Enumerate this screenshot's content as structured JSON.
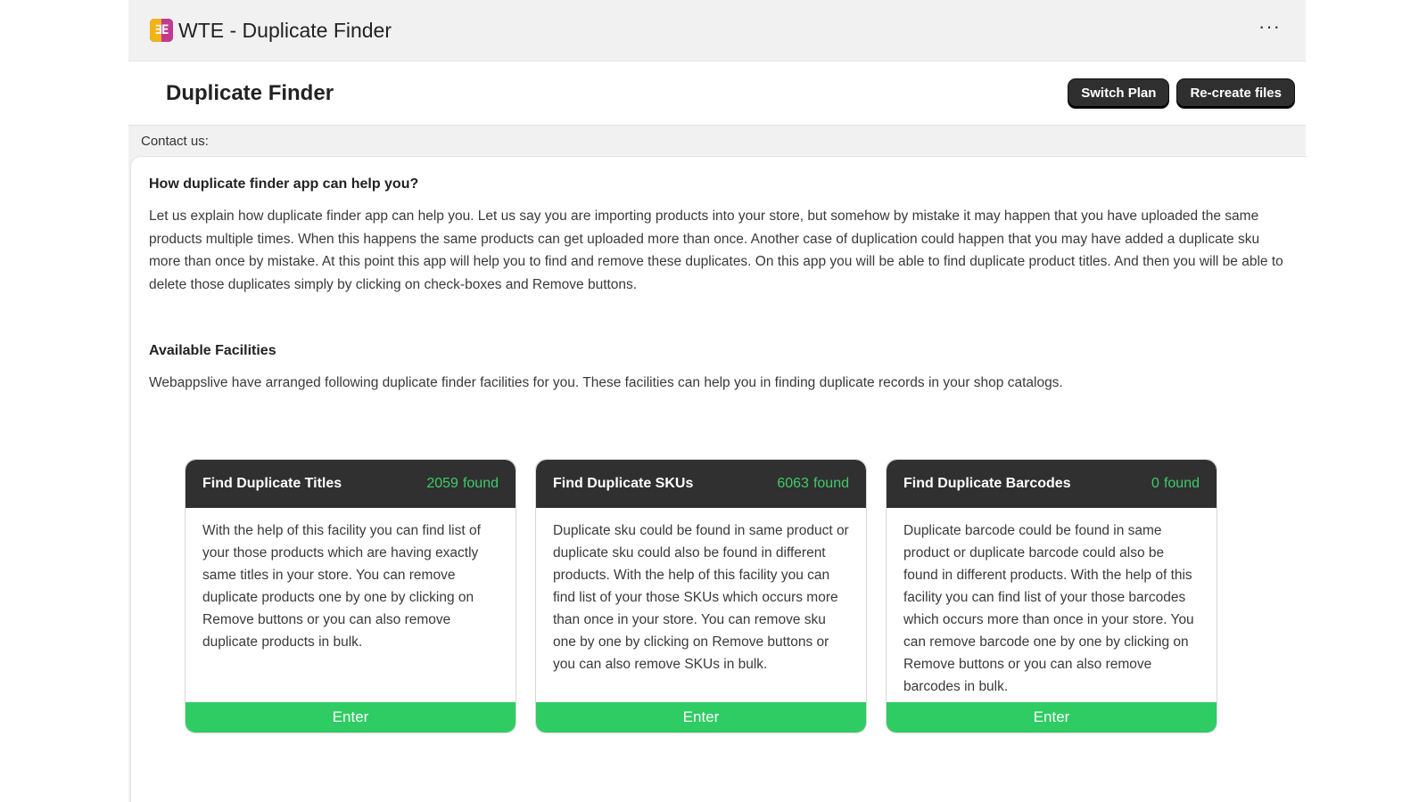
{
  "app": {
    "title": "WTE - Duplicate Finder",
    "logo_text": "∃E",
    "more_label": "···"
  },
  "header": {
    "page_title": "Duplicate Finder",
    "switch_plan_label": "Switch Plan",
    "recreate_label": "Re-create files"
  },
  "contact": {
    "label": "Contact us:"
  },
  "intro": {
    "heading": "How duplicate finder app can help you?",
    "text": "Let us explain how duplicate finder app can help you. Let us say you are importing products into your store, but somehow by mistake it may happen that you have uploaded the same products multiple times. When this happens the same products can get uploaded more than once. Another case of duplication could happen that you may have added a duplicate sku more than once by mistake. At this point this app will help you to find and remove these duplicates. On this app you will be able to find duplicate product titles. And then you will be able to delete those duplicates simply by clicking on check-boxes and Remove buttons."
  },
  "facilities": {
    "heading": "Available Facilities",
    "text": "Webappslive have arranged following duplicate finder facilities for you. These facilities can help you in finding duplicate records in your shop catalogs."
  },
  "cards": [
    {
      "title": "Find Duplicate Titles",
      "count": "2059",
      "count_suffix": "found",
      "body": "With the help of this facility you can find list of your those products which are having exactly same titles in your store. You can remove duplicate products one by one by clicking on Remove buttons or you can also remove duplicate products in bulk.",
      "enter_label": "Enter"
    },
    {
      "title": "Find Duplicate SKUs",
      "count": "6063",
      "count_suffix": "found",
      "body": "Duplicate sku could be found in same product or duplicate sku could also be found in different products. With the help of this facility you can find list of your those SKUs which occurs more than once in your store. You can remove sku one by one by clicking on Remove buttons or you can also remove SKUs in bulk.",
      "enter_label": "Enter"
    },
    {
      "title": "Find Duplicate Barcodes",
      "count": "0",
      "count_suffix": "found",
      "body": "Duplicate barcode could be found in same product or duplicate barcode could also be found in different products. With the help of this facility you can find list of your those barcodes which occurs more than once in your store. You can remove barcode one by one by clicking on Remove buttons or you can also remove barcodes in bulk.",
      "enter_label": "Enter"
    }
  ],
  "colors": {
    "accent_green": "#2ecc63",
    "count_green": "#3ecb6a",
    "dark": "#303030"
  }
}
